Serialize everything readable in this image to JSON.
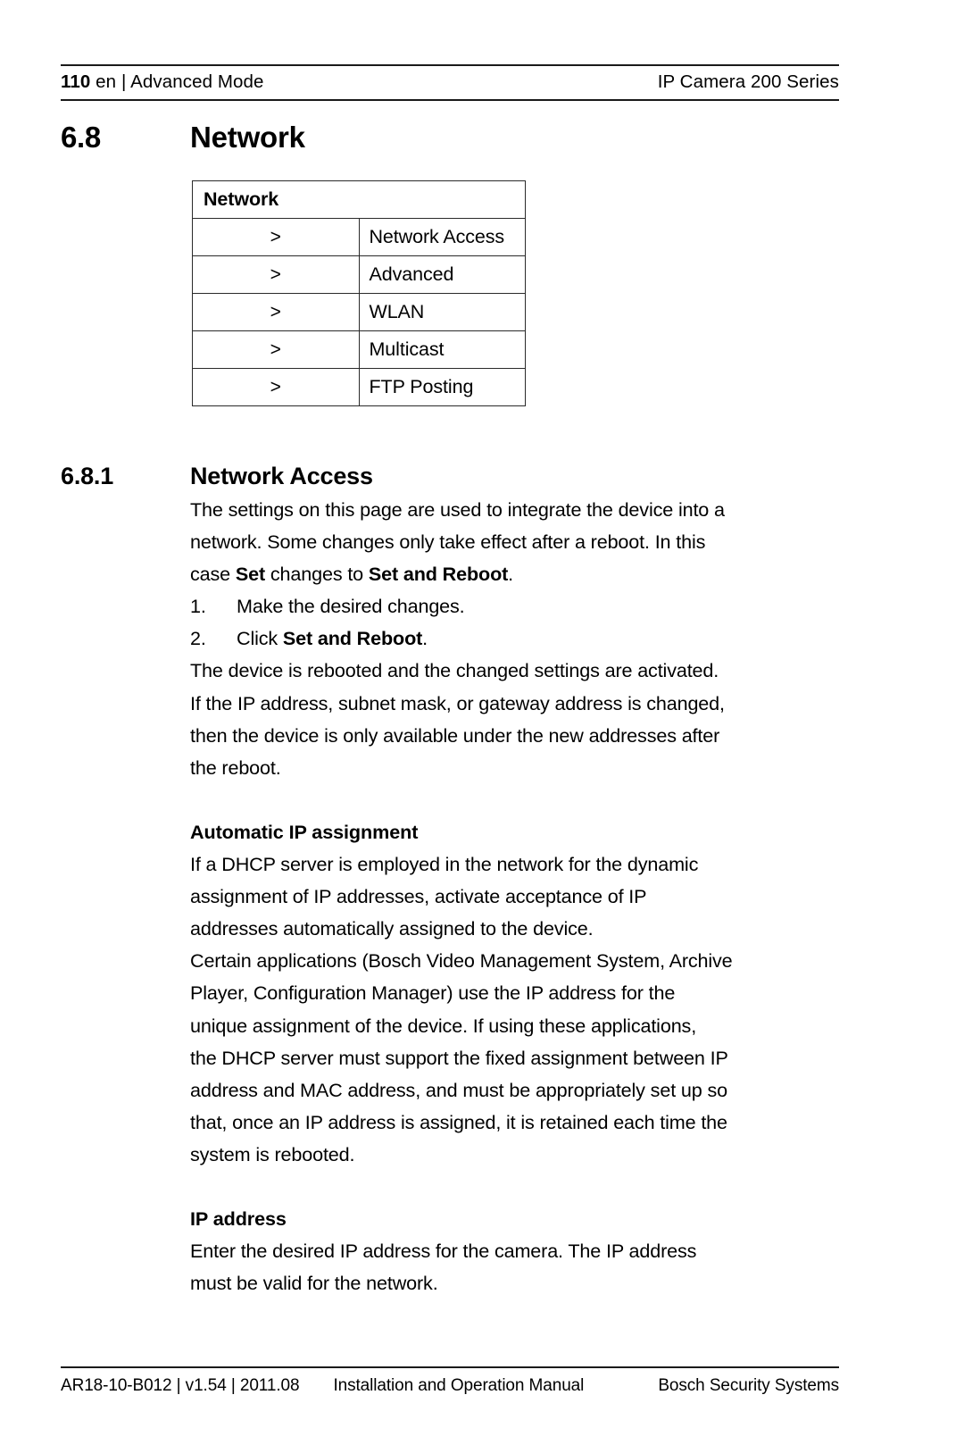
{
  "header": {
    "page_number": "110",
    "language": "en",
    "separator": "|",
    "section_name": "Advanced Mode",
    "product": "IP Camera 200 Series"
  },
  "section": {
    "number": "6.8",
    "title": "Network"
  },
  "menu_table": {
    "header": "Network",
    "rows": [
      {
        "arrow": ">",
        "label": "Network Access"
      },
      {
        "arrow": ">",
        "label": "Advanced"
      },
      {
        "arrow": ">",
        "label": "WLAN"
      },
      {
        "arrow": ">",
        "label": "Multicast"
      },
      {
        "arrow": ">",
        "label": "FTP Posting"
      }
    ]
  },
  "subsection": {
    "number": "6.8.1",
    "title": "Network Access",
    "intro_line1": "The settings on this page are used to integrate the device into a",
    "intro_line2": "network. Some changes only take effect after a reboot. In this",
    "intro_line3_pre": "case ",
    "intro_line3_bold1": "Set",
    "intro_line3_mid": " changes to ",
    "intro_line3_bold2": "Set and Reboot",
    "intro_line3_post": ".",
    "steps": [
      {
        "num": "1.",
        "text": "Make the desired changes."
      },
      {
        "num": "2.",
        "text_pre": "Click ",
        "text_bold": "Set and Reboot",
        "text_post": "."
      }
    ],
    "after_steps_line1": "The device is rebooted and the changed settings are activated.",
    "after_steps_line2": "If the IP address, subnet mask, or gateway address is changed,",
    "after_steps_line3": "then the device is only available under the new addresses after",
    "after_steps_line4": "the reboot."
  },
  "auto_ip": {
    "heading": "Automatic IP assignment",
    "para1_line1": "If a DHCP server is employed in the network for the dynamic",
    "para1_line2": "assignment of IP addresses, activate acceptance of IP",
    "para1_line3": "addresses automatically assigned to the device.",
    "para2_line1": "Certain applications (Bosch Video Management System, Archive",
    "para2_line2": "Player, Configuration Manager) use the IP address for the",
    "para2_line3": "unique assignment of the device. If using these applications,",
    "para2_line4": "the DHCP server must support the fixed assignment between IP",
    "para2_line5": "address and MAC address, and must be appropriately set up so",
    "para2_line6": "that, once an IP address is assigned, it is retained each time the",
    "para2_line7": "system is rebooted."
  },
  "ip_address": {
    "heading": "IP address",
    "para_line1": "Enter the desired IP address for the camera. The IP address",
    "para_line2": "must be valid for the network."
  },
  "footer": {
    "doc_id": "AR18-10-B012 | v1.54 | 2011.08",
    "manual_title": "Installation and Operation Manual",
    "company": "Bosch Security Systems"
  }
}
